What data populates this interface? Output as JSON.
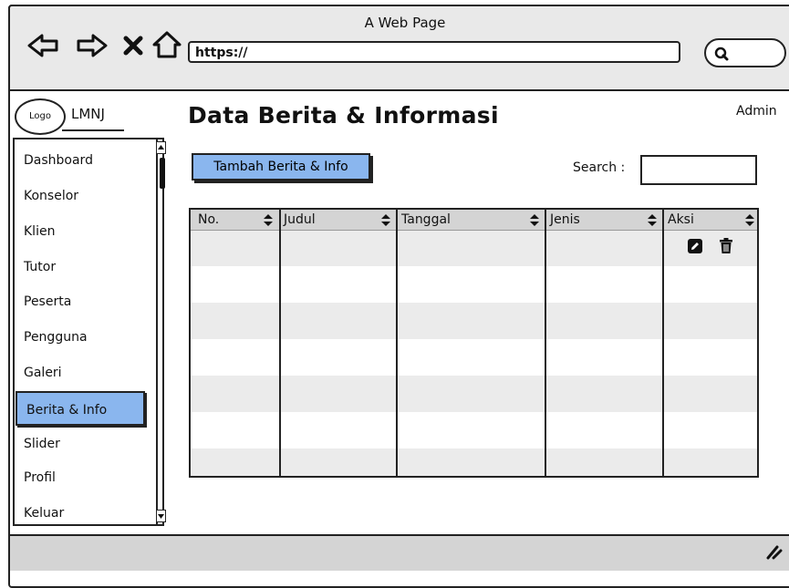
{
  "window": {
    "title": "A Web Page"
  },
  "browser": {
    "url": "https://",
    "icons": [
      "back-arrow-icon",
      "forward-arrow-icon",
      "close-x-icon",
      "home-icon",
      "search-icon"
    ]
  },
  "brand": {
    "logo": "Logo",
    "name": "LMNJ"
  },
  "header": {
    "title": "Data Berita & Informasi",
    "user": "Admin"
  },
  "sidebar": {
    "items": [
      {
        "label": "Dashboard"
      },
      {
        "label": "Konselor"
      },
      {
        "label": "Klien"
      },
      {
        "label": "Tutor"
      },
      {
        "label": "Peserta"
      },
      {
        "label": "Pengguna"
      },
      {
        "label": "Galeri"
      },
      {
        "label": "Berita & Info",
        "active": true
      },
      {
        "label": "Slider"
      },
      {
        "label": "Profil"
      },
      {
        "label": "Keluar"
      }
    ]
  },
  "toolbar": {
    "add_label": "Tambah Berita & Info",
    "search_label": "Search :",
    "search_value": ""
  },
  "table": {
    "columns": [
      "No.",
      "Judul",
      "Tanggal",
      "Jenis",
      "Aksi"
    ],
    "row_actions": [
      "edit-icon",
      "trash-icon"
    ]
  },
  "colors": {
    "accent": "#8ab6ee",
    "chrome": "#e9e9e9",
    "header_row": "#d4d4d4",
    "stripe": "#ebebeb"
  }
}
